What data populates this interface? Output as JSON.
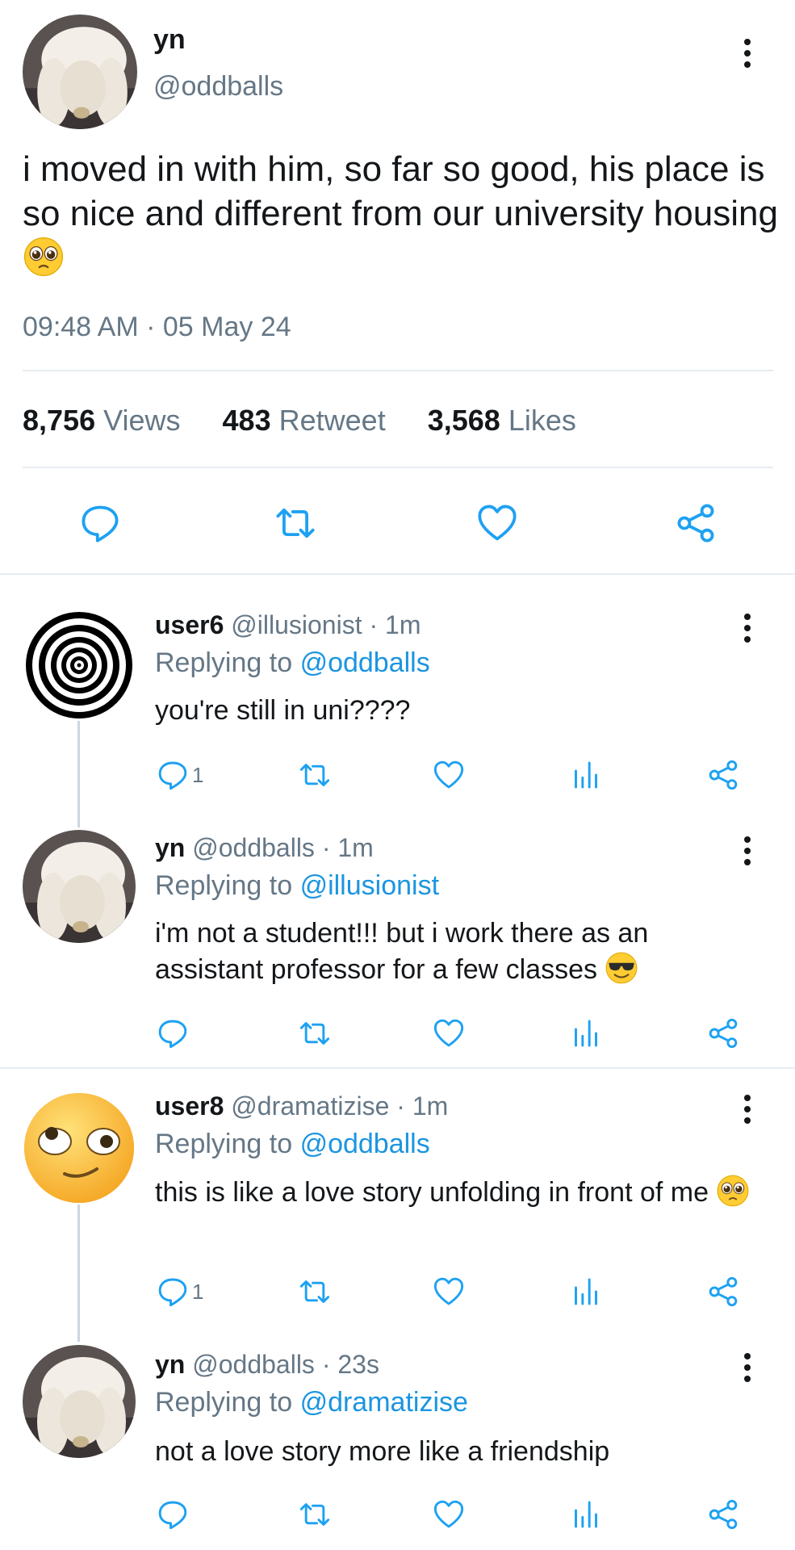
{
  "main_tweet": {
    "display_name": "yn",
    "handle": "@oddballs",
    "text": "i moved in with him, so far so good, his place is so nice and different from our university housing",
    "time": "09:48 AM",
    "date": "05 May 24",
    "separator": "·",
    "stats": {
      "views": "8,756",
      "views_label": "Views",
      "retweets": "483",
      "retweets_label": "Retweet",
      "likes": "3,568",
      "likes_label": "Likes"
    }
  },
  "replies": [
    {
      "display_name": "user6",
      "handle": "@illusionist",
      "age": "· 1m",
      "replying_prefix": "Replying to",
      "replying_to": "@oddballs",
      "text": "you're still in uni????",
      "reply_count": "1"
    },
    {
      "display_name": "yn",
      "handle": "@oddballs",
      "age": "· 1m",
      "replying_prefix": "Replying to",
      "replying_to": "@illusionist",
      "text": "i'm not a student!!! but i work there as an assistant professor for a few classes",
      "reply_count": ""
    },
    {
      "display_name": "user8",
      "handle": "@dramatizise",
      "age": "· 1m",
      "replying_prefix": "Replying to",
      "replying_to": "@oddballs",
      "text": "this is like a love story unfolding in front of me",
      "reply_count": "1"
    },
    {
      "display_name": "yn",
      "handle": "@oddballs",
      "age": "· 23s",
      "replying_prefix": "Replying to",
      "replying_to": "@dramatizise",
      "text": "not a love story more like a friendship",
      "reply_count": ""
    }
  ],
  "colors": {
    "accent": "#1b95e0",
    "muted": "#657786",
    "divider": "#e6ecf0",
    "icon": "#1da1f2"
  },
  "icons": [
    "more-vertical-icon",
    "reply-icon",
    "retweet-icon",
    "like-icon",
    "share-icon",
    "analytics-icon",
    "pleading-face-emoji",
    "sunglasses-face-emoji"
  ]
}
